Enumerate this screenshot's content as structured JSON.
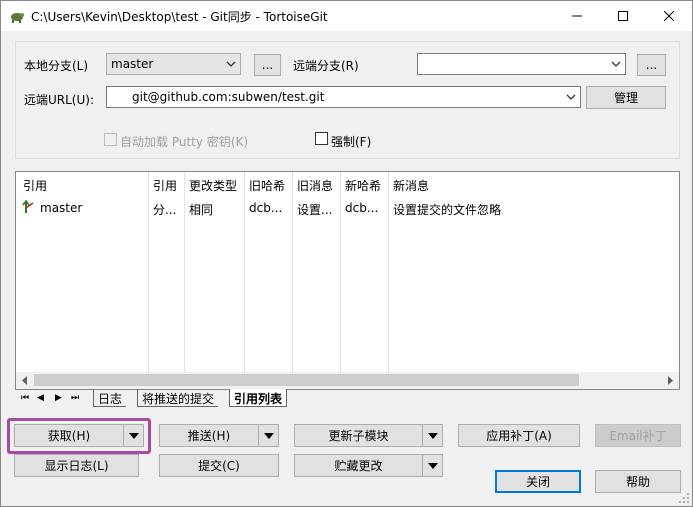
{
  "window": {
    "title": "C:\\Users\\Kevin\\Desktop\\test - Git同步 - TortoiseGit",
    "minimize": "—",
    "maximize": "☐",
    "close": "✕"
  },
  "form": {
    "local_branch_label": "本地分支(L)",
    "local_branch_value": "master",
    "browse_label": "...",
    "remote_branch_label": "远端分支(R)",
    "remote_branch_value": "",
    "remote_url_label": "远端URL(U):",
    "remote_url_value": "git@github.com:subwen/test.git",
    "manage_label": "管理",
    "autoload_putty_label": "自动加载 Putty 密钥(K)",
    "force_label": "强制(F)"
  },
  "list": {
    "columns": [
      "引用",
      "引用",
      "更改类型",
      "旧哈希",
      "旧消息",
      "新哈希",
      "新消息"
    ],
    "rows": [
      {
        "ref": "master",
        "reftype": "分...",
        "change": "相同",
        "old_hash": "dcb...",
        "old_msg": "设置...",
        "new_hash": "dcb...",
        "new_msg": "设置提交的文件忽略"
      }
    ]
  },
  "tabs": {
    "nav": [
      "⏮",
      "◀",
      "▶",
      "⏭"
    ],
    "items": [
      "日志",
      "将推送的提交",
      "引用列表"
    ],
    "active_index": 2
  },
  "buttons": {
    "fetch": "获取(H)",
    "push": "推送(H)",
    "update_submodule": "更新子模块",
    "apply_patch": "应用补丁(A)",
    "email_patch": "Email补丁",
    "show_log": "显示日志(L)",
    "commit": "提交(C)",
    "stash": "贮藏更改",
    "close": "关闭",
    "help": "帮助"
  },
  "colors": {
    "highlight": "#a64ca6",
    "default_button_border": "#0078d7"
  }
}
